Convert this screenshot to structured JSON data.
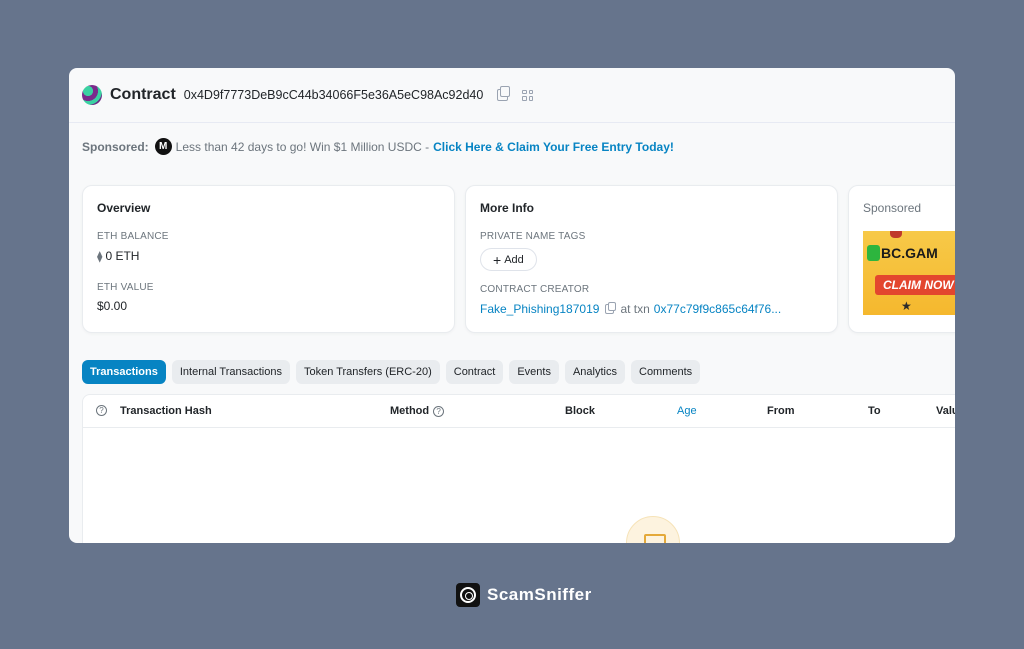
{
  "header": {
    "title": "Contract",
    "address": "0x4D9f7773DeB9cC44b34066F5e36A5eC98Ac92d40"
  },
  "sponsor_line": {
    "label": "Sponsored:",
    "icon_letter": "M",
    "text": "Less than 42 days to go! Win $1 Million USDC -",
    "link": "Click Here & Claim Your Free Entry Today!"
  },
  "overview": {
    "heading": "Overview",
    "eth_balance_label": "ETH BALANCE",
    "eth_balance_glyph": "⧫",
    "eth_balance_value": "0 ETH",
    "eth_value_label": "ETH VALUE",
    "eth_value_value": "$0.00"
  },
  "more_info": {
    "heading": "More Info",
    "private_tags_label": "PRIVATE NAME TAGS",
    "add_label": "Add",
    "creator_label": "CONTRACT CREATOR",
    "creator_name": "Fake_Phishing187019",
    "at_txn": "at txn",
    "txn_hash": "0x77c79f9c865c64f76..."
  },
  "sponsored_card": {
    "heading": "Sponsored",
    "ad_logo": "BC.GAM",
    "ad_claim": "CLAIM NOW"
  },
  "tabs": [
    {
      "label": "Transactions",
      "active": true
    },
    {
      "label": "Internal Transactions",
      "active": false
    },
    {
      "label": "Token Transfers (ERC-20)",
      "active": false
    },
    {
      "label": "Contract",
      "active": false
    },
    {
      "label": "Events",
      "active": false
    },
    {
      "label": "Analytics",
      "active": false
    },
    {
      "label": "Comments",
      "active": false
    }
  ],
  "table": {
    "columns": {
      "hash": "Transaction Hash",
      "method": "Method",
      "block": "Block",
      "age": "Age",
      "from": "From",
      "to": "To",
      "value": "Valu"
    }
  },
  "brand": {
    "name": "ScamSniffer"
  },
  "colors": {
    "accent": "#0784c3",
    "background": "#66748c",
    "ad_red": "#e3462e",
    "ad_yellow": "#f7c948"
  }
}
